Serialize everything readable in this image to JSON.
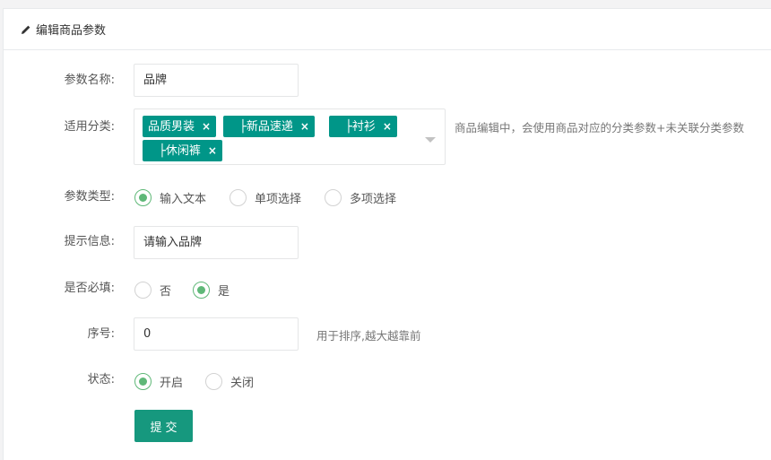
{
  "panel": {
    "title": "编辑商品参数",
    "icon": "pencil-icon"
  },
  "fields": {
    "param_name": {
      "label": "参数名称:",
      "value": "品牌"
    },
    "category": {
      "label": "适用分类:",
      "tags": [
        "品质男装",
        "├新品速递",
        "├衬衫",
        "├休闲裤"
      ],
      "remove": "×",
      "tip": "商品编辑中，会使用商品对应的分类参数+未关联分类参数"
    },
    "param_type": {
      "label": "参数类型:",
      "options": [
        "输入文本",
        "单项选择",
        "多项选择"
      ],
      "selected": "输入文本"
    },
    "hint": {
      "label": "提示信息:",
      "value": "请输入品牌"
    },
    "required": {
      "label": "是否必填:",
      "options": [
        "否",
        "是"
      ],
      "selected": "是"
    },
    "order": {
      "label": "序号:",
      "value": "0",
      "tip": "用于排序,越大越靠前"
    },
    "status": {
      "label": "状态:",
      "options": [
        "开启",
        "关闭"
      ],
      "selected": "开启"
    }
  },
  "submit_label": "提交",
  "colors": {
    "tag": "#009688",
    "radio_on": "#5fb878",
    "button": "#16987e"
  }
}
